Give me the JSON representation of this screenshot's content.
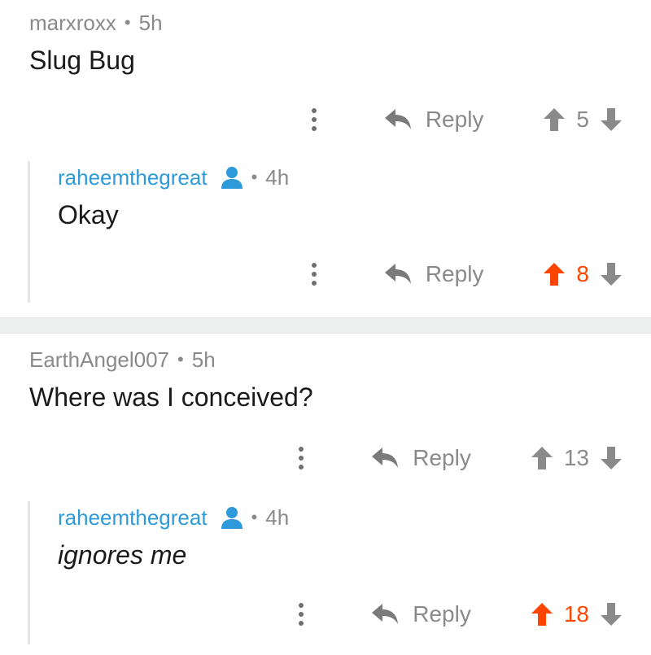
{
  "threads": [
    {
      "comment": {
        "author": "marxroxx",
        "time": "5h",
        "text": "Slug Bug",
        "reply_label": "Reply",
        "score": "5",
        "upvoted": false
      },
      "reply": {
        "author": "raheemthegreat",
        "time": "4h",
        "text": "Okay",
        "reply_label": "Reply",
        "score": "8",
        "upvoted": true
      }
    },
    {
      "comment": {
        "author": "EarthAngel007",
        "time": "5h",
        "text": "Where was I conceived?",
        "reply_label": "Reply",
        "score": "13",
        "upvoted": false
      },
      "reply": {
        "author": "raheemthegreat",
        "time": "4h",
        "text": "ignores me",
        "reply_label": "Reply",
        "score": "18",
        "upvoted": true
      }
    }
  ],
  "colors": {
    "upvote_active": "#ff4500",
    "vote_inactive": "#8a8a8a",
    "username_link": "#2e9ad9",
    "divider": "#eef0f0"
  },
  "icons": {
    "more": "more-vertical-icon",
    "reply": "reply-arrow-icon",
    "upvote": "arrow-up-icon",
    "downvote": "arrow-down-icon",
    "user": "user-icon"
  }
}
